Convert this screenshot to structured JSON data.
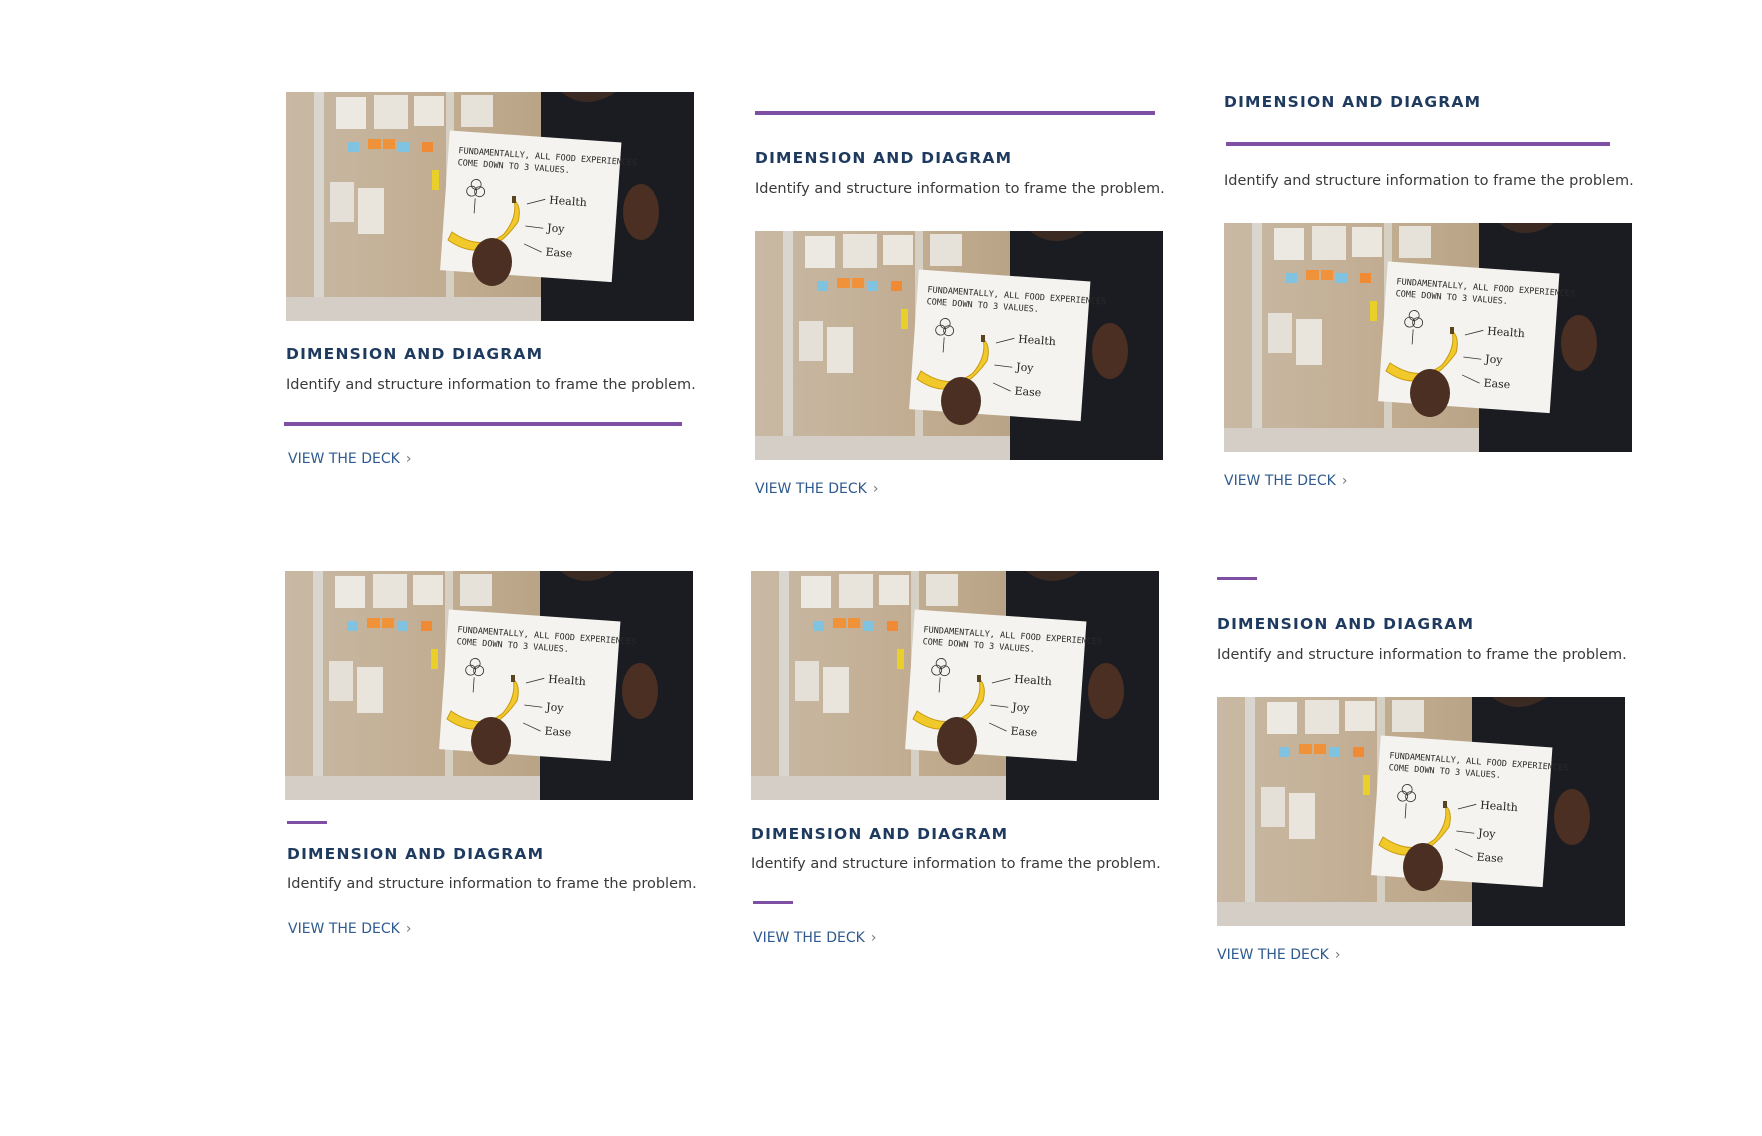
{
  "colors": {
    "accent_rule": "#7f4fa3",
    "title": "#1e3a5f",
    "link": "#2f5a8f",
    "text": "#3a3a3a"
  },
  "image": {
    "icon": "photo-person-holding-banana-sign",
    "sign_line1": "FUNDAMENTALLY, ALL FOOD EXPERIENCES",
    "sign_line2": "COME DOWN TO 3 VALUES.",
    "sign_health": "Health",
    "sign_joy": "Joy",
    "sign_ease": "Ease"
  },
  "cards": [
    {
      "title": "DIMENSION AND DIAGRAM",
      "description": "Identify and structure information to frame the problem.",
      "link": "VIEW THE DECK"
    },
    {
      "title": "DIMENSION AND DIAGRAM",
      "description": "Identify and structure information to frame the problem.",
      "link": "VIEW THE DECK"
    },
    {
      "title": "DIMENSION AND DIAGRAM",
      "description": "Identify and structure information to frame the problem.",
      "link": "VIEW THE DECK"
    },
    {
      "title": "DIMENSION AND DIAGRAM",
      "description": "Identify and structure information to frame the problem.",
      "link": "VIEW THE DECK"
    },
    {
      "title": "DIMENSION AND DIAGRAM",
      "description": "Identify and structure information to frame the problem.",
      "link": "VIEW THE DECK"
    },
    {
      "title": "DIMENSION AND DIAGRAM",
      "description": "Identify and structure information to frame the problem.",
      "link": "VIEW THE DECK"
    }
  ]
}
